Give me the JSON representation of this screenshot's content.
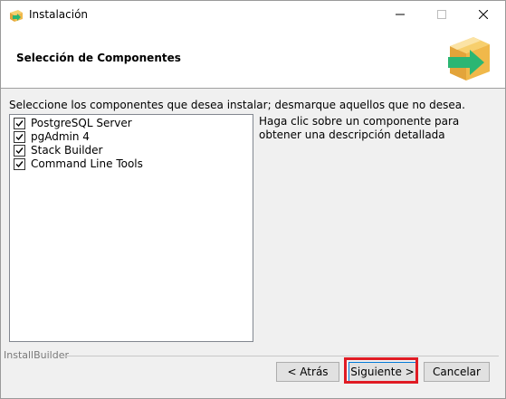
{
  "window": {
    "title": "Instalación",
    "icon": "installer-box-arrow-icon",
    "controls": [
      "minimize",
      "maximize",
      "close"
    ]
  },
  "header": {
    "title": "Selección de Componentes",
    "logo": "box-arrow-logo"
  },
  "instruction": "Seleccione los componentes que desea instalar; desmarque aquellos que no desea.",
  "components": [
    {
      "label": "PostgreSQL Server",
      "checked": true
    },
    {
      "label": "pgAdmin 4",
      "checked": true
    },
    {
      "label": "Stack Builder",
      "checked": true
    },
    {
      "label": "Command Line Tools",
      "checked": true
    }
  ],
  "description": "Haga clic sobre un componente para obtener una descripción detallada",
  "footer": {
    "brand": "InstallBuilder",
    "back_label": "< Atrás",
    "next_label": "Siguiente >",
    "cancel_label": "Cancelar"
  },
  "colors": {
    "highlight": "#e01b24",
    "box": "#f0b84a",
    "arrow": "#2bb673",
    "focus_border": "#0078d7"
  }
}
